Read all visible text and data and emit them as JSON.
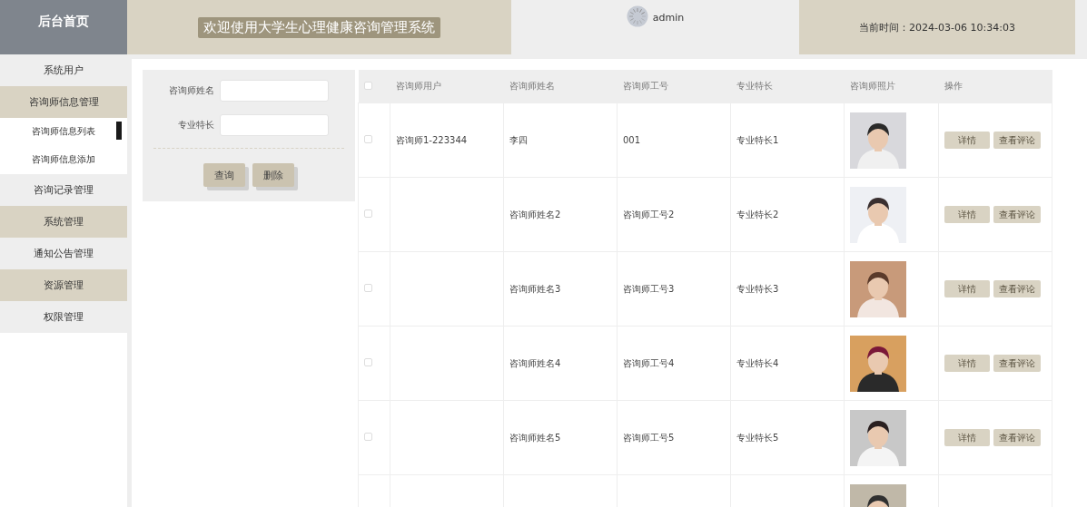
{
  "header": {
    "home": "后台首页",
    "title": "欢迎使用大学生心理健康咨询管理系统",
    "user": "admin",
    "time_label": "当前时间：",
    "time": "2024-03-06 10:34:03"
  },
  "sidebar": {
    "items": [
      {
        "label": "系统用户",
        "selected": false
      },
      {
        "label": "咨询师信息管理",
        "selected": false,
        "expanded": true,
        "children": [
          {
            "label": "咨询师信息列表",
            "selected": true
          },
          {
            "label": "咨询师信息添加",
            "selected": false
          }
        ]
      },
      {
        "label": "咨询记录管理",
        "selected": false
      },
      {
        "label": "系统管理",
        "selected": false
      },
      {
        "label": "通知公告管理",
        "selected": false
      },
      {
        "label": "资源管理",
        "selected": false
      },
      {
        "label": "权限管理",
        "selected": false
      }
    ]
  },
  "search": {
    "fields": [
      {
        "label": "咨询师姓名"
      },
      {
        "label": "专业特长"
      }
    ],
    "buttons": [
      "查询",
      "删除"
    ]
  },
  "table": {
    "header_checked": false,
    "columns": [
      "咨询师用户",
      "咨询师姓名",
      "咨询师工号",
      "专业特长",
      "咨询师照片",
      "操作"
    ],
    "rows": [
      {
        "checked": false,
        "user": "咨询师1-223344",
        "name": "李四",
        "number": "001",
        "specialty": "专业特长1",
        "photo": {
          "kind": "picture"
        },
        "actions": [
          "详情",
          "查看评论"
        ]
      },
      {
        "checked": false,
        "name": "咨询师姓名2",
        "number": "咨询师工号2",
        "specialty": "专业特长2",
        "photo": {
          "kind": "picture"
        },
        "actions": [
          "详情",
          "查看评论"
        ]
      },
      {
        "checked": false,
        "name": "咨询师姓名3",
        "number": "咨询师工号3",
        "specialty": "专业特长3",
        "photo": {
          "kind": "picture"
        },
        "actions": [
          "详情",
          "查看评论"
        ]
      },
      {
        "checked": false,
        "name": "咨询师姓名4",
        "number": "咨询师工号4",
        "specialty": "专业特长4",
        "photo": {
          "kind": "picture"
        },
        "actions": [
          "详情",
          "查看评论"
        ]
      },
      {
        "checked": false,
        "name": "咨询师姓名5",
        "number": "咨询师工号5",
        "specialty": "专业特长5",
        "photo": {
          "kind": "picture"
        },
        "actions": [
          "详情",
          "查看评论"
        ]
      },
      {
        "photo": {
          "kind": "picture"
        }
      }
    ]
  }
}
